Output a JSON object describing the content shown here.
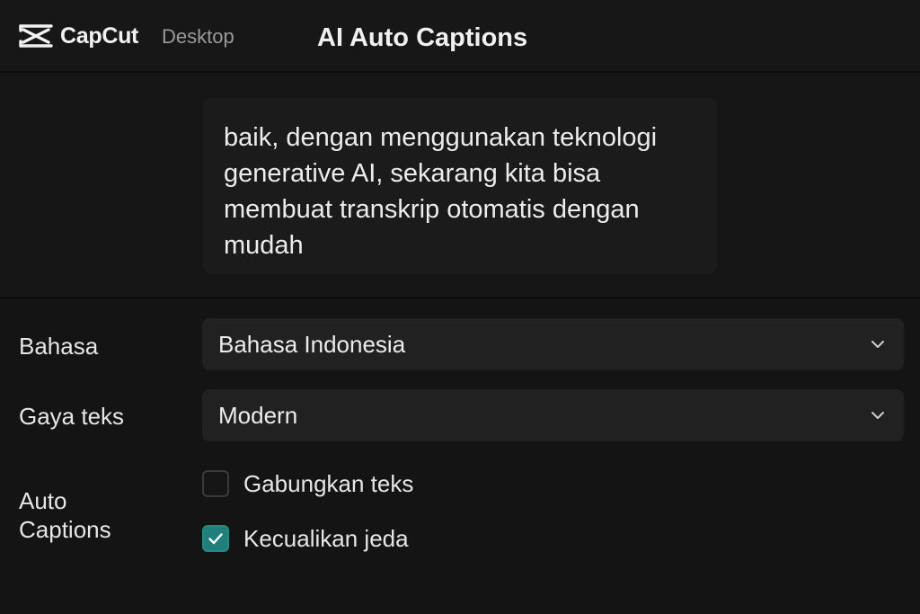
{
  "header": {
    "brand_name": "CapCut",
    "brand_sub": "Desktop",
    "title": "AI Auto Captions"
  },
  "preview": {
    "caption_lines": [
      "baik, dengan menggunakan teknologi",
      "generative AI, sekarang kita bisa",
      "membuat transkrip otomatis dengan",
      "mudah"
    ]
  },
  "settings": {
    "language": {
      "label": "Bahasa",
      "value": "Bahasa Indonesia"
    },
    "text_style": {
      "label": "Gaya teks",
      "value": "Modern"
    },
    "auto_captions": {
      "label_lines": [
        "Auto",
        "Captions"
      ],
      "options": [
        {
          "label": "Gabungkan teks",
          "checked": false
        },
        {
          "label": "Kecualikan jeda",
          "checked": true
        }
      ]
    }
  },
  "icons": {
    "brand_logo": "capcut-logo-icon",
    "dropdown": "chevron-down-icon",
    "check": "checkmark-icon"
  },
  "colors": {
    "background": "#141414",
    "field": "#212121",
    "accent_checked": "#1f7f7b"
  }
}
